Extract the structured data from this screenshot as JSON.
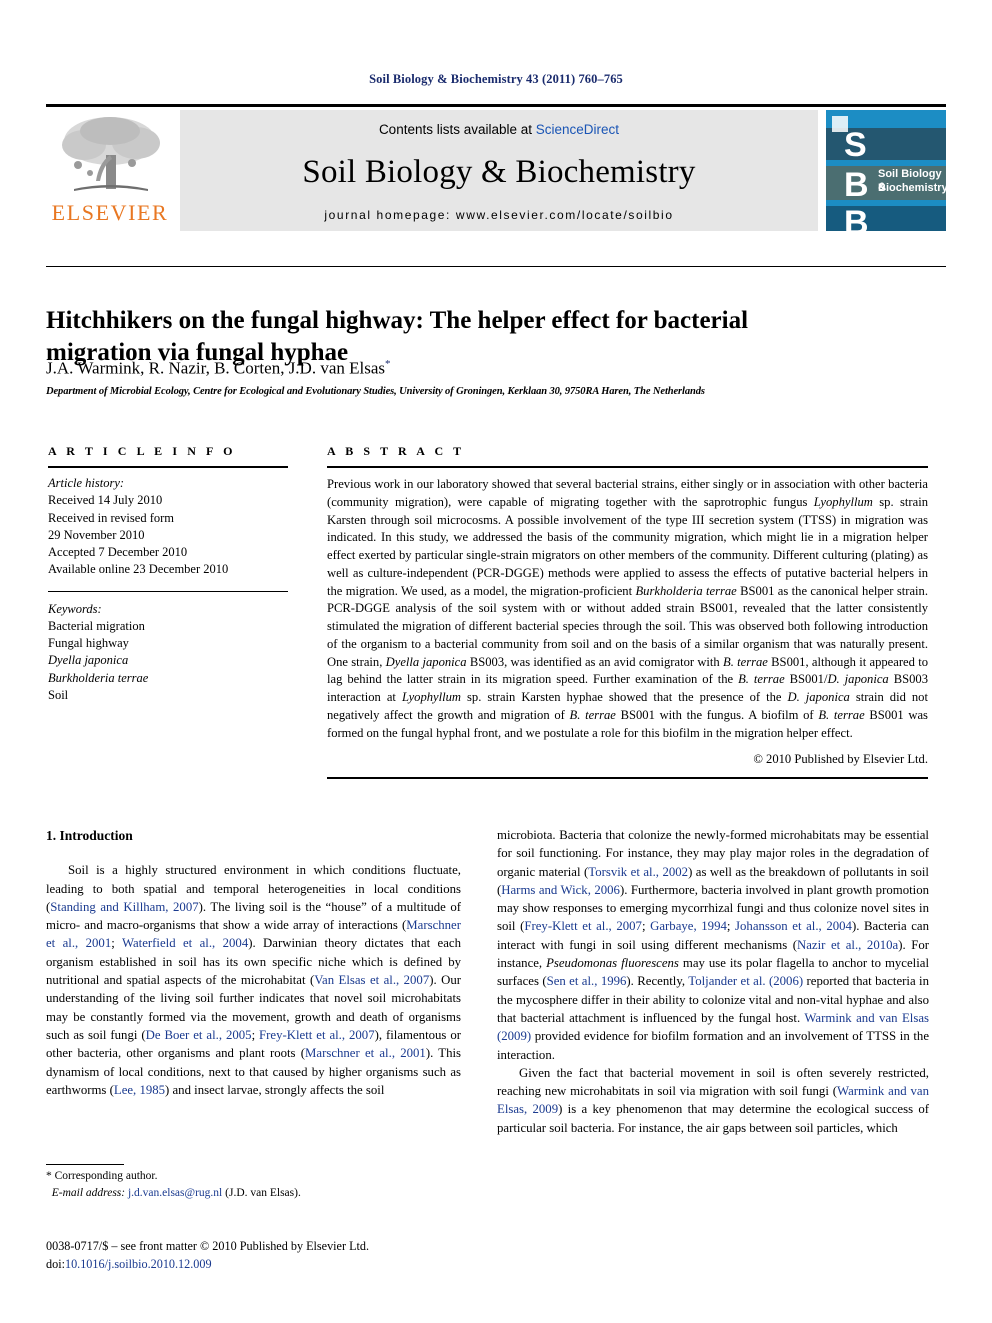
{
  "running_head": "Soil Biology & Biochemistry 43 (2011) 760–765",
  "masthead": {
    "publisher_logo_label": "ELSEVIER",
    "contents_prefix": "Contents lists available at ",
    "contents_link": "ScienceDirect",
    "journal_title": "Soil Biology & Biochemistry",
    "homepage": "journal homepage: www.elsevier.com/locate/soilbio",
    "cover": {
      "letters": [
        "S",
        "B",
        "B"
      ],
      "name_line1": "Soil Biology &",
      "name_line2": "Biochemistry",
      "background_color": "#1c8dc4"
    }
  },
  "article": {
    "title": "Hitchhikers on the fungal highway: The helper effect for bacterial migration via fungal hyphae",
    "authors": "J.A. Warmink, R. Nazir, B. Corten, J.D. van Elsas",
    "author_marker": "*",
    "affiliation": "Department of Microbial Ecology, Centre for Ecological and Evolutionary Studies, University of Groningen, Kerklaan 30, 9750RA Haren, The Netherlands"
  },
  "article_info": {
    "heading": "A R T I C L E   I N F O",
    "history_label": "Article history:",
    "history": [
      "Received 14 July 2010",
      "Received in revised form",
      "29 November 2010",
      "Accepted 7 December 2010",
      "Available online 23 December 2010"
    ],
    "keywords_label": "Keywords:",
    "keywords": [
      "Bacterial migration",
      "Fungal highway",
      "Dyella japonica",
      "Burkholderia terrae",
      "Soil"
    ],
    "keywords_italic": [
      false,
      false,
      true,
      true,
      false
    ]
  },
  "abstract": {
    "heading": "A B S T R A C T",
    "text_parts": [
      {
        "t": "Previous work in our laboratory showed that several bacterial strains, either singly or in association with other bacteria (community migration), were capable of migrating together with the saprotrophic fungus "
      },
      {
        "t": "Lyophyllum",
        "i": true
      },
      {
        "t": " sp. strain Karsten through soil microcosms. A possible involvement of the type III secretion system (TTSS) in migration was indicated. In this study, we addressed the basis of the community migration, which might lie in a migration helper effect exerted by particular single-strain migrators on other members of the community. Different culturing (plating) as well as culture-independent (PCR-DGGE) methods were applied to assess the effects of putative bacterial helpers in the migration. We used, as a model, the migration-proficient "
      },
      {
        "t": "Burkholderia terrae",
        "i": true
      },
      {
        "t": " BS001 as the canonical helper strain. PCR-DGGE analysis of the soil system with or without added strain BS001, revealed that the latter consistently stimulated the migration of different bacterial species through the soil. This was observed both following introduction of the organism to a bacterial community from soil and on the basis of a similar organism that was naturally present. One strain, "
      },
      {
        "t": "Dyella japonica",
        "i": true
      },
      {
        "t": " BS003, was identified as an avid comigrator with "
      },
      {
        "t": "B. terrae",
        "i": true
      },
      {
        "t": " BS001, although it appeared to lag behind the latter strain in its migration speed. Further examination of the "
      },
      {
        "t": "B. terrae",
        "i": true
      },
      {
        "t": " BS001/"
      },
      {
        "t": "D. japonica",
        "i": true
      },
      {
        "t": " BS003 interaction at "
      },
      {
        "t": "Lyophyllum",
        "i": true
      },
      {
        "t": " sp. strain Karsten hyphae showed that the presence of the "
      },
      {
        "t": "D. japonica",
        "i": true
      },
      {
        "t": " strain did not negatively affect the growth and migration of "
      },
      {
        "t": "B. terrae",
        "i": true
      },
      {
        "t": " BS001 with the fungus. A biofilm of "
      },
      {
        "t": "B. terrae",
        "i": true
      },
      {
        "t": " BS001 was formed on the fungal hyphal front, and we postulate a role for this biofilm in the migration helper effect."
      }
    ],
    "copyright": "© 2010 Published by Elsevier Ltd."
  },
  "body": {
    "section_number_title": "1. Introduction",
    "left_column": [
      {
        "t": "Soil is a highly structured environment in which conditions fluctuate, leading to both spatial and temporal heterogeneities in local conditions ("
      },
      {
        "t": "Standing and Killham, 2007",
        "r": true
      },
      {
        "t": "). The living soil is the “house” of a multitude of micro- and macro-organisms that show a wide array of interactions ("
      },
      {
        "t": "Marschner et al., 2001",
        "r": true
      },
      {
        "t": "; "
      },
      {
        "t": "Waterfield et al., 2004",
        "r": true
      },
      {
        "t": "). Darwinian theory dictates that each organism established in soil has its own specific niche which is defined by nutritional and spatial aspects of the microhabitat ("
      },
      {
        "t": "Van Elsas et al., 2007",
        "r": true
      },
      {
        "t": "). Our understanding of the living soil further indicates that novel soil microhabitats may be constantly formed via the movement, growth and death of organisms such as soil fungi ("
      },
      {
        "t": "De Boer et al., 2005",
        "r": true
      },
      {
        "t": "; "
      },
      {
        "t": "Frey-Klett et al., 2007",
        "r": true
      },
      {
        "t": "), filamentous or other bacteria, other organisms and plant roots ("
      },
      {
        "t": "Marschner et al., 2001",
        "r": true
      },
      {
        "t": "). This dynamism of local conditions, next to that caused by higher organisms such as earthworms ("
      },
      {
        "t": "Lee, 1985",
        "r": true
      },
      {
        "t": ") and insect larvae, strongly affects the soil"
      }
    ],
    "right_column_para1": [
      {
        "t": "microbiota. Bacteria that colonize the newly-formed microhabitats may be essential for soil functioning. For instance, they may play major roles in the degradation of organic material ("
      },
      {
        "t": "Torsvik et al., 2002",
        "r": true
      },
      {
        "t": ") as well as the breakdown of pollutants in soil ("
      },
      {
        "t": "Harms and Wick, 2006",
        "r": true
      },
      {
        "t": "). Furthermore, bacteria involved in plant growth promotion may show responses to emerging mycorrhizal fungi and thus colonize novel sites in soil ("
      },
      {
        "t": "Frey-Klett et al., 2007",
        "r": true
      },
      {
        "t": "; "
      },
      {
        "t": "Garbaye, 1994",
        "r": true
      },
      {
        "t": "; "
      },
      {
        "t": "Johansson et al., 2004",
        "r": true
      },
      {
        "t": "). Bacteria can interact with fungi in soil using different mechanisms ("
      },
      {
        "t": "Nazir et al., 2010a",
        "r": true
      },
      {
        "t": "). For instance, "
      },
      {
        "t": "Pseudomonas fluorescens",
        "i": true
      },
      {
        "t": " may use its polar flagella to anchor to mycelial surfaces ("
      },
      {
        "t": "Sen et al., 1996",
        "r": true
      },
      {
        "t": "). Recently, "
      },
      {
        "t": "Toljander et al. (2006)",
        "r": true
      },
      {
        "t": " reported that bacteria in the mycosphere differ in their ability to colonize vital and non-vital hyphae and also that bacterial attachment is influenced by the fungal host. "
      },
      {
        "t": "Warmink and van Elsas (2009)",
        "r": true
      },
      {
        "t": " provided evidence for biofilm formation and an involvement of TTSS in the interaction."
      }
    ],
    "right_column_para2": [
      {
        "t": "Given the fact that bacterial movement in soil is often severely restricted, reaching new microhabitats in soil via migration with soil fungi ("
      },
      {
        "t": "Warmink and van Elsas, 2009",
        "r": true
      },
      {
        "t": ") is a key phenomenon that may determine the ecological success of particular soil bacteria. For instance, the air gaps between soil particles, which"
      }
    ]
  },
  "footnote": {
    "corresponding": "* Corresponding author.",
    "email_label": "E-mail address:",
    "email": "j.d.van.elsas@rug.nl",
    "email_suffix": "(J.D. van Elsas)."
  },
  "imprint": {
    "line1": "0038-0717/$ – see front matter © 2010 Published by Elsevier Ltd.",
    "doi_label": "doi:",
    "doi": "10.1016/j.soilbio.2010.12.009"
  },
  "colors": {
    "link_blue": "#1a55b5",
    "ref_blue": "#1a3a8f",
    "header_blue": "#1a2b6d",
    "elsevier_orange": "#e87722",
    "panel_grey": "#e6e6e6",
    "cover_blue": "#1c8dc4"
  }
}
